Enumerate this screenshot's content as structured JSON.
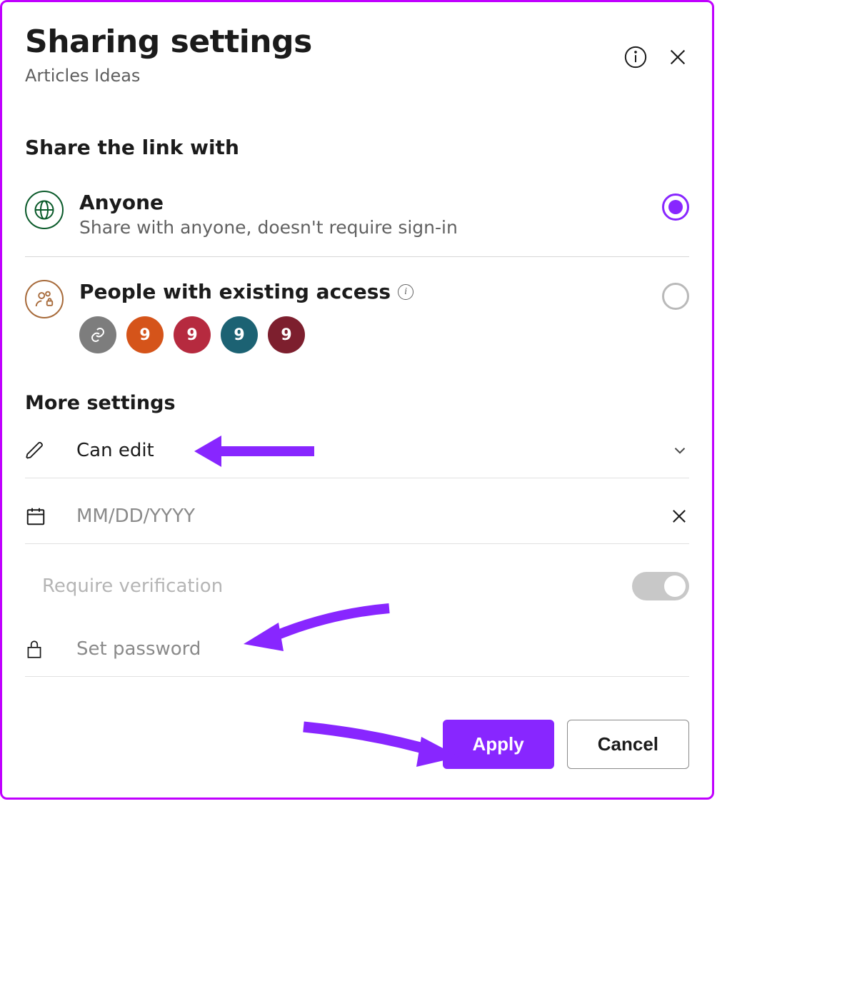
{
  "header": {
    "title": "Sharing settings",
    "subtitle": "Articles Ideas"
  },
  "shareSection": {
    "label": "Share the link with",
    "options": {
      "anyone": {
        "title": "Anyone",
        "subtitle": "Share with anyone, doesn't require sign-in",
        "selected": true
      },
      "existing": {
        "title": "People with existing access",
        "selected": false,
        "avatars": [
          "link",
          "9",
          "9",
          "9",
          "9"
        ]
      }
    }
  },
  "moreSettings": {
    "label": "More settings",
    "permission": "Can edit",
    "datePlaceholder": "MM/DD/YYYY",
    "verifyLabel": "Require verification",
    "verifyOn": false,
    "passwordPlaceholder": "Set password"
  },
  "buttons": {
    "apply": "Apply",
    "cancel": "Cancel"
  }
}
